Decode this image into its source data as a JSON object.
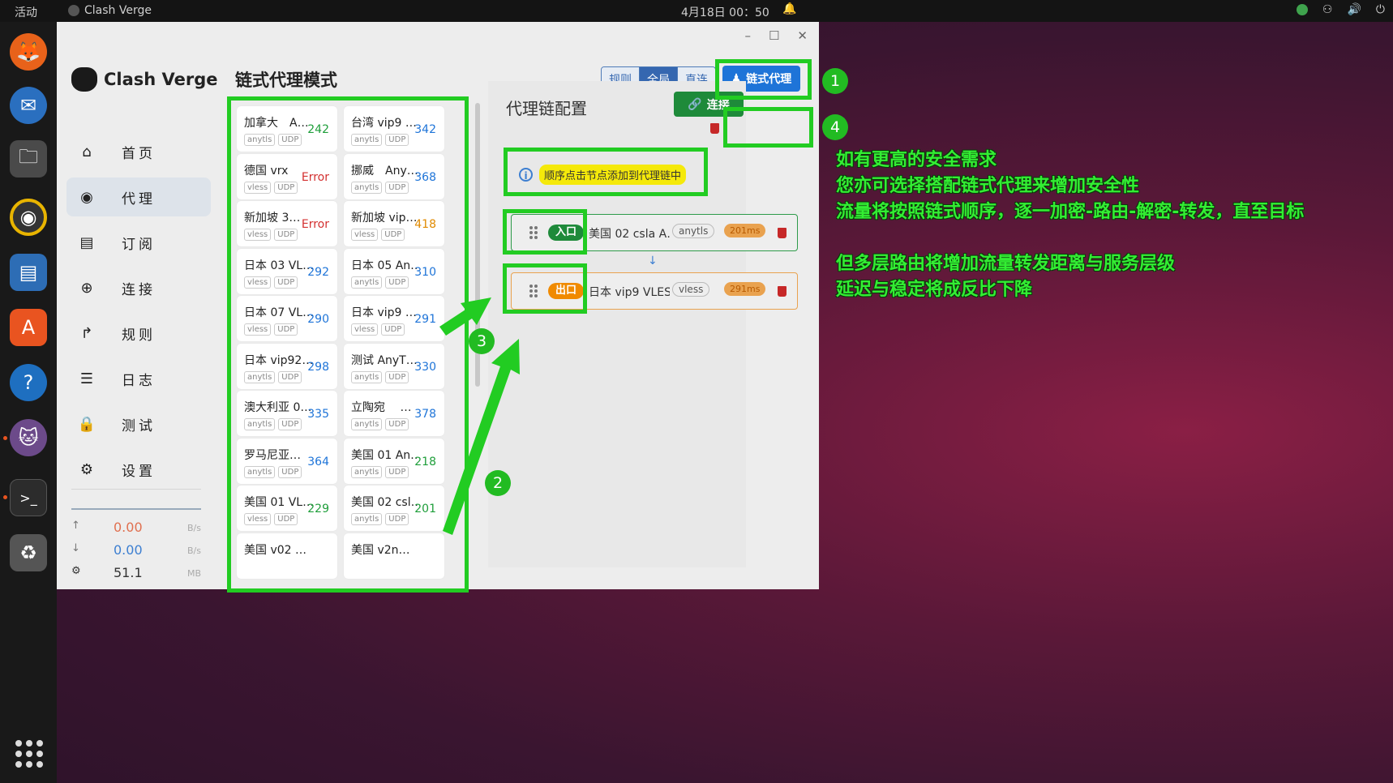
{
  "topbar": {
    "activities": "活动",
    "app_name": "Clash Verge",
    "clock": "4月18日  00：50"
  },
  "app": {
    "logo_text": "Clash Verge",
    "page_title": "链式代理模式",
    "nav": [
      {
        "label": "首页",
        "icon": "home-icon"
      },
      {
        "label": "代理",
        "icon": "wifi-icon"
      },
      {
        "label": "订阅",
        "icon": "server-icon"
      },
      {
        "label": "连接",
        "icon": "globe-icon"
      },
      {
        "label": "规则",
        "icon": "fork-icon"
      },
      {
        "label": "日志",
        "icon": "list-icon"
      },
      {
        "label": "测试",
        "icon": "lock-icon"
      },
      {
        "label": "设置",
        "icon": "gear-icon"
      }
    ],
    "traffic": {
      "up_value": "0.00",
      "up_unit": "B/s",
      "down_value": "0.00",
      "down_unit": "B/s",
      "mem_value": "51.1",
      "mem_unit": "MB"
    },
    "modes": [
      "规则",
      "全局",
      "直连"
    ],
    "selected_mode": "全局",
    "chain_button": "链式代理",
    "proxies": [
      {
        "name": "加拿大　A…",
        "tags": [
          "anytls",
          "UDP"
        ],
        "latency": "242",
        "color": "#1e9e3a"
      },
      {
        "name": "台湾 vip9 …",
        "tags": [
          "anytls",
          "UDP"
        ],
        "latency": "342",
        "color": "#1e74d8"
      },
      {
        "name": "德国 vrx",
        "tags": [
          "vless",
          "UDP"
        ],
        "latency": "Error",
        "color": "#d32f2f"
      },
      {
        "name": "挪威　Any…",
        "tags": [
          "anytls",
          "UDP"
        ],
        "latency": "368",
        "color": "#1e74d8"
      },
      {
        "name": "新加坡 3…",
        "tags": [
          "vless",
          "UDP"
        ],
        "latency": "Error",
        "color": "#d32f2f"
      },
      {
        "name": "新加坡 vip…",
        "tags": [
          "vless",
          "UDP"
        ],
        "latency": "418",
        "color": "#e08a00"
      },
      {
        "name": "日本 03 VL…",
        "tags": [
          "vless",
          "UDP"
        ],
        "latency": "292",
        "color": "#1e74d8"
      },
      {
        "name": "日本 05 An…",
        "tags": [
          "anytls",
          "UDP"
        ],
        "latency": "310",
        "color": "#1e74d8"
      },
      {
        "name": "日本 07 VL…",
        "tags": [
          "vless",
          "UDP"
        ],
        "latency": "290",
        "color": "#1e74d8"
      },
      {
        "name": "日本 vip9 …",
        "tags": [
          "vless",
          "UDP"
        ],
        "latency": "291",
        "color": "#1e74d8"
      },
      {
        "name": "日本 vip92…",
        "tags": [
          "anytls",
          "UDP"
        ],
        "latency": "298",
        "color": "#1e74d8"
      },
      {
        "name": "测试 AnyT…",
        "tags": [
          "anytls",
          "UDP"
        ],
        "latency": "330",
        "color": "#1e74d8"
      },
      {
        "name": "澳大利亚 0…",
        "tags": [
          "anytls",
          "UDP"
        ],
        "latency": "335",
        "color": "#1e74d8"
      },
      {
        "name": "立陶宛　 …",
        "tags": [
          "anytls",
          "UDP"
        ],
        "latency": "378",
        "color": "#1e74d8"
      },
      {
        "name": "罗马尼亚…",
        "tags": [
          "anytls",
          "UDP"
        ],
        "latency": "364",
        "color": "#1e74d8"
      },
      {
        "name": "美国 01 An…",
        "tags": [
          "anytls",
          "UDP"
        ],
        "latency": "218",
        "color": "#1e9e3a"
      },
      {
        "name": "美国 01 VL…",
        "tags": [
          "vless",
          "UDP"
        ],
        "latency": "229",
        "color": "#1e9e3a"
      },
      {
        "name": "美国 02 csl…",
        "tags": [
          "anytls",
          "UDP"
        ],
        "latency": "201",
        "color": "#1e9e3a"
      },
      {
        "name": "美国 v02 …",
        "tags": [],
        "latency": "",
        "color": "#1e74d8"
      },
      {
        "name": "美国 v2n…",
        "tags": [],
        "latency": "",
        "color": "#1e74d8"
      }
    ],
    "chain": {
      "title": "代理链配置",
      "connect_button": "连接",
      "tip": "顺序点击节点添加到代理链中",
      "entry": {
        "badge": "入口",
        "name": "美国 02 csla A…",
        "type": "anytls",
        "ms": "201ms"
      },
      "exit": {
        "badge": "出口",
        "name": "日本 vip9 VLES…",
        "type": "vless",
        "ms": "291ms"
      }
    }
  },
  "annotations": {
    "numbers": [
      "1",
      "2",
      "3",
      "4"
    ],
    "lines": [
      "如有更高的安全需求",
      "您亦可选择搭配链式代理来增加安全性",
      "流量将按照链式顺序，逐一加密-路由-解密-转发，直至目标",
      "",
      "但多层路由将增加流量转发距离与服务层级",
      "延迟与稳定将成反比下降"
    ],
    "color": "#33ee33"
  }
}
